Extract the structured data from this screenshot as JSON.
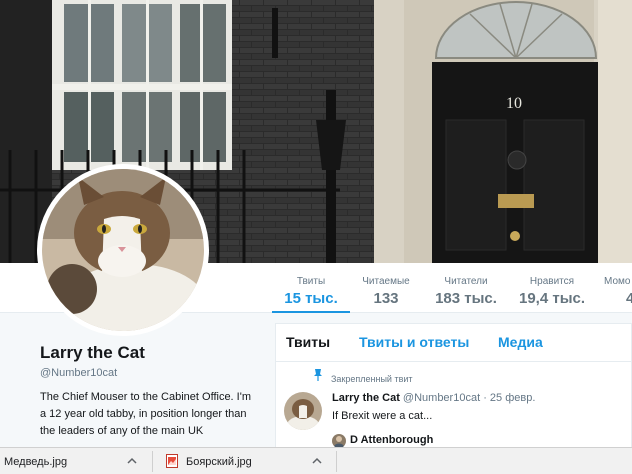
{
  "banner": {
    "door_number": "10"
  },
  "profile": {
    "name": "Larry the Cat",
    "handle": "@Number10cat",
    "bio": "The Chief Mouser to the Cabinet Office. I'm a 12 year old tabby, in position longer than the leaders of any of the main UK"
  },
  "stats": [
    {
      "label": "Твиты",
      "value": "15 тыс."
    },
    {
      "label": "Читаемые",
      "value": "133"
    },
    {
      "label": "Читатели",
      "value": "183 тыс."
    },
    {
      "label": "Нравится",
      "value": "19,4 тыс."
    },
    {
      "label": "Момо",
      "value": "4"
    }
  ],
  "timeline": {
    "tabs": [
      "Твиты",
      "Твиты и ответы",
      "Медиа"
    ],
    "pinned_label": "Закрепленный твит",
    "tweet": {
      "name": "Larry the Cat",
      "handle": "@Number10cat",
      "separator": "·",
      "date": "25 февр.",
      "text": "If Brexit were a cat...",
      "quote_name": "D Attenborough"
    }
  },
  "downloads": [
    {
      "name": "Медведь.jpg",
      "icon": "image-file-icon"
    },
    {
      "name": "Боярский.jpg",
      "icon": "image-file-icon"
    }
  ],
  "colors": {
    "accent": "#1b95e0",
    "muted": "#657786",
    "panel": "#f5f8fa"
  }
}
